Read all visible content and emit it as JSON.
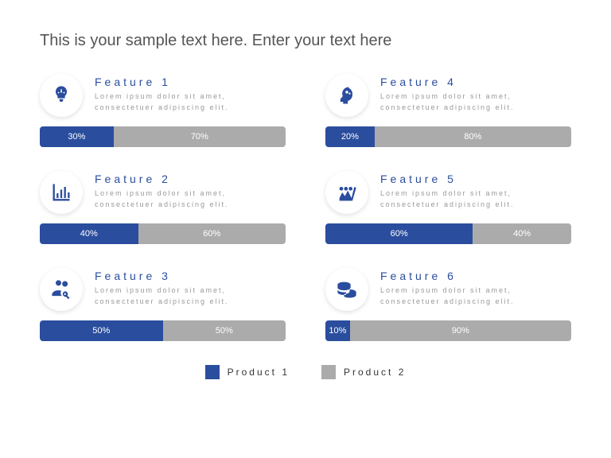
{
  "title": "This is your sample text here. Enter your text here",
  "features": [
    {
      "title": "Feature 1",
      "desc": "Lorem ipsum dolor sit amet, consectetuer adipiscing elit.",
      "p1": 30,
      "p2": 70,
      "icon": "lightbulb"
    },
    {
      "title": "Feature 4",
      "desc": "Lorem ipsum dolor sit amet, consectetuer adipiscing elit.",
      "p1": 20,
      "p2": 80,
      "icon": "head-gears"
    },
    {
      "title": "Feature 2",
      "desc": "Lorem ipsum dolor sit amet, consectetuer adipiscing elit.",
      "p1": 40,
      "p2": 60,
      "icon": "bar-chart"
    },
    {
      "title": "Feature 5",
      "desc": "Lorem ipsum dolor sit amet, consectetuer adipiscing elit.",
      "p1": 60,
      "p2": 40,
      "icon": "people-arrow"
    },
    {
      "title": "Feature 3",
      "desc": "Lorem ipsum dolor sit amet, consectetuer adipiscing elit.",
      "p1": 50,
      "p2": 50,
      "icon": "people-search"
    },
    {
      "title": "Feature 6",
      "desc": "Lorem ipsum dolor sit amet, consectetuer adipiscing elit.",
      "p1": 10,
      "p2": 90,
      "icon": "coins"
    }
  ],
  "legend": {
    "p1": "Product 1",
    "p2": "Product 2"
  },
  "chart_data": {
    "type": "bar",
    "title": "This is your sample text here. Enter your text here",
    "categories": [
      "Feature 1",
      "Feature 2",
      "Feature 3",
      "Feature 4",
      "Feature 5",
      "Feature 6"
    ],
    "series": [
      {
        "name": "Product 1",
        "values": [
          30,
          40,
          50,
          20,
          60,
          10
        ]
      },
      {
        "name": "Product 2",
        "values": [
          70,
          60,
          50,
          80,
          40,
          90
        ]
      }
    ],
    "ylim": [
      0,
      100
    ],
    "unit": "%"
  }
}
